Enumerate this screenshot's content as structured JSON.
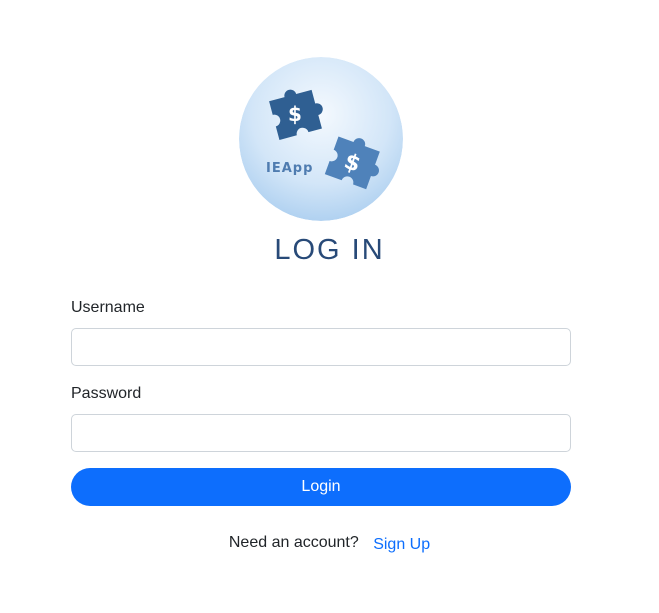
{
  "logo": {
    "text": "IEApp",
    "piece_symbol": "$",
    "colors": {
      "circle_top": "#eaf3fb",
      "circle_bottom": "#a9cdef",
      "piece_dark": "#2f5f92",
      "piece_light": "#5d8fc4"
    }
  },
  "page_title": "LOG IN",
  "form": {
    "username_label": "Username",
    "username_value": "",
    "password_label": "Password",
    "password_value": "",
    "login_label": "Login"
  },
  "signup": {
    "prompt": "Need an account?",
    "link_label": "Sign Up"
  },
  "colors": {
    "primary": "#0d6efd",
    "title": "#284a78"
  }
}
